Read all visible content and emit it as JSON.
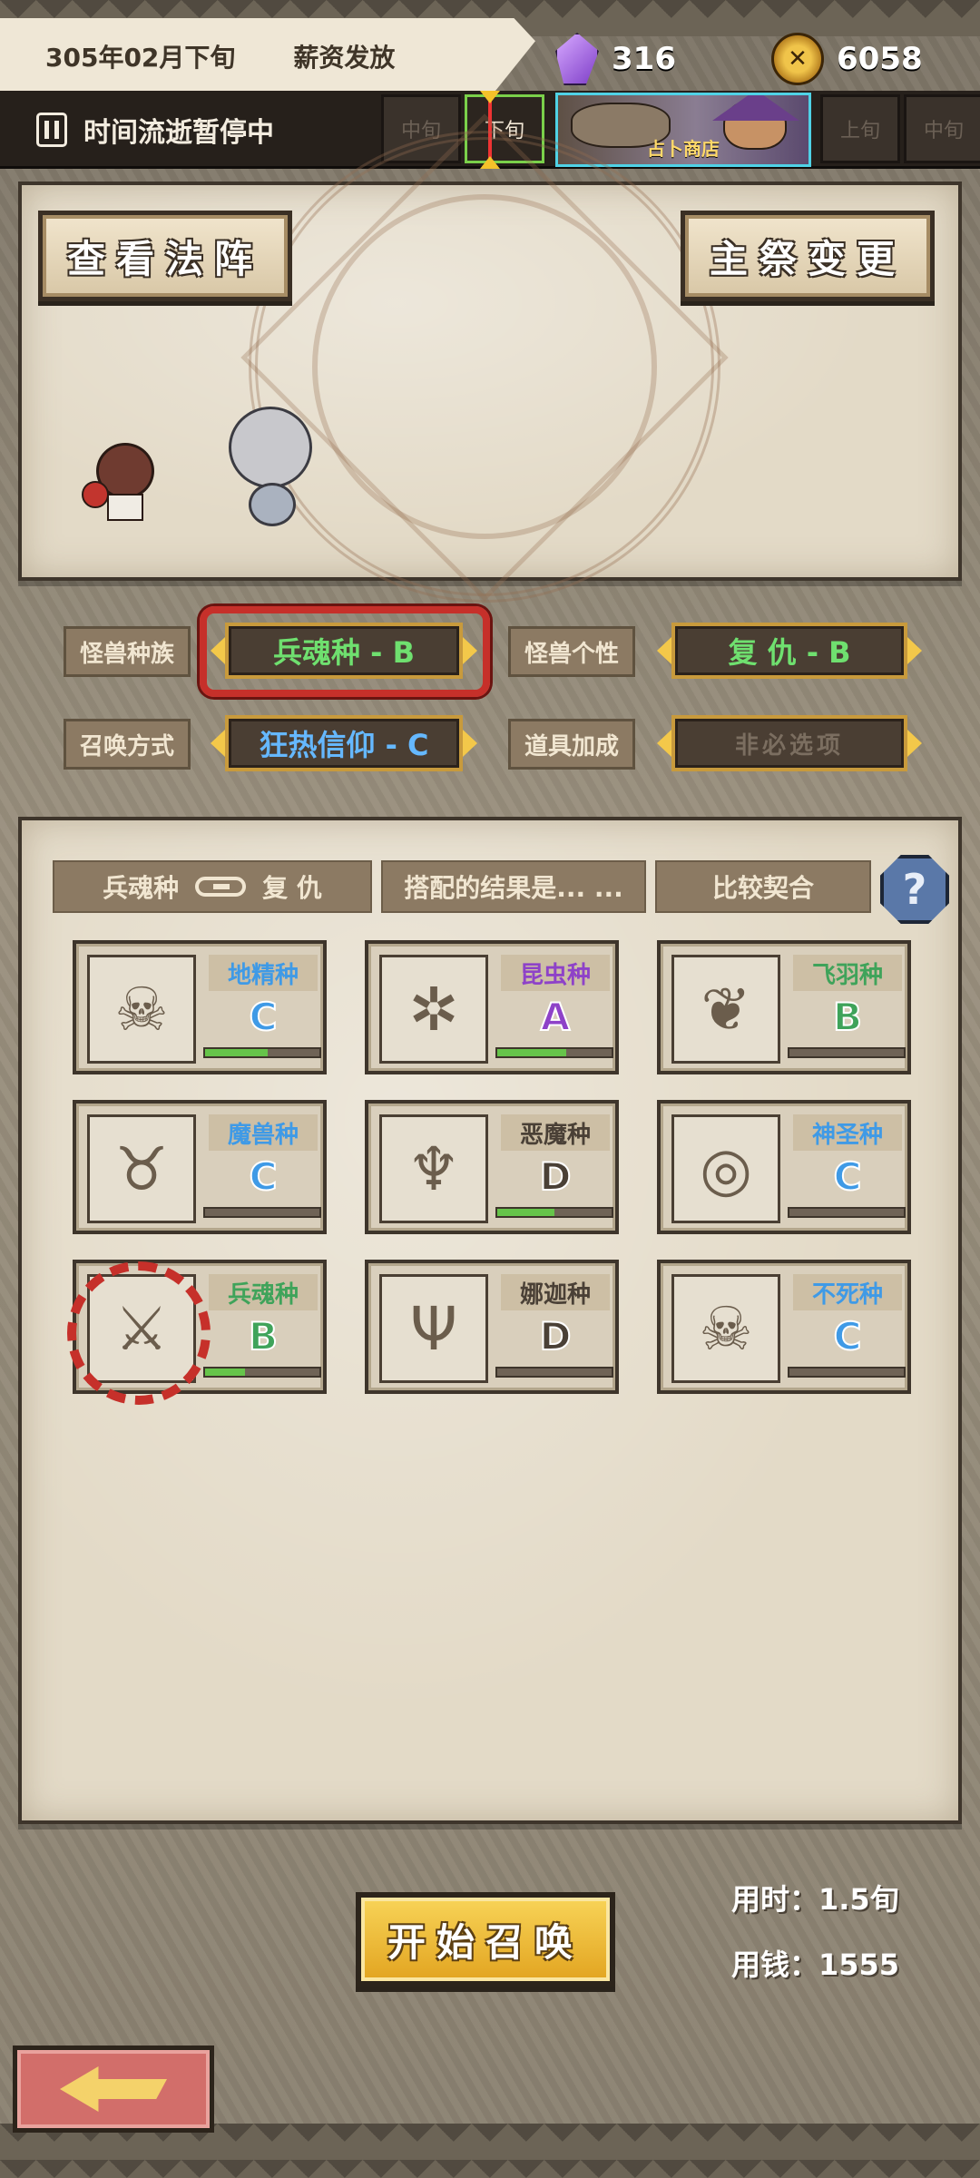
{
  "topbar": {
    "date": "305年02月下旬",
    "event": "薪资发放",
    "crystals": "316",
    "coins": "6058",
    "time_status": "时间流逝暂停中",
    "periods": [
      "中旬",
      "下旬",
      "上旬",
      "中旬"
    ],
    "shop_label": "占卜商店"
  },
  "altar": {
    "view_button": "查看法阵",
    "change_button": "主祭变更"
  },
  "options": {
    "race_label": "怪兽种族",
    "race_value": "兵魂种 - B",
    "personality_label": "怪兽个性",
    "personality_value": "复 仇 - B",
    "summon_label": "召唤方式",
    "summon_value": "狂热信仰 - C",
    "item_label": "道具加成",
    "item_value": "非必选项"
  },
  "result": {
    "race": "兵魂种",
    "personality": "复 仇",
    "prompt": "搭配的结果是... ...",
    "verdict": "比较契合",
    "help": "?"
  },
  "races": [
    {
      "name": "地精种",
      "grade": "C",
      "progress": 0.55,
      "color": "#3f9ae6",
      "icon": "goblin-skull-icon"
    },
    {
      "name": "昆虫种",
      "grade": "A",
      "progress": 0.6,
      "color": "#8e42c8",
      "icon": "insect-icon"
    },
    {
      "name": "飞羽种",
      "grade": "B",
      "progress": 0.0,
      "color": "#3fa35a",
      "icon": "wings-icon"
    },
    {
      "name": "魔兽种",
      "grade": "C",
      "progress": 0.0,
      "color": "#3f9ae6",
      "icon": "beast-icon"
    },
    {
      "name": "恶魔种",
      "grade": "D",
      "progress": 0.5,
      "color": "#4a4036",
      "icon": "demon-icon"
    },
    {
      "name": "神圣种",
      "grade": "C",
      "progress": 0.0,
      "color": "#3f9ae6",
      "icon": "halo-icon"
    },
    {
      "name": "兵魂种",
      "grade": "B",
      "progress": 0.35,
      "color": "#3fa35a",
      "icon": "sword-icon"
    },
    {
      "name": "娜迦种",
      "grade": "D",
      "progress": 0.0,
      "color": "#4a4036",
      "icon": "trident-icon"
    },
    {
      "name": "不死种",
      "grade": "C",
      "progress": 0.0,
      "color": "#3f9ae6",
      "icon": "skull-icon"
    }
  ],
  "summon": {
    "start_button": "开始召唤",
    "time_cost": "用时：1.5旬",
    "money_cost": "用钱：1555"
  }
}
